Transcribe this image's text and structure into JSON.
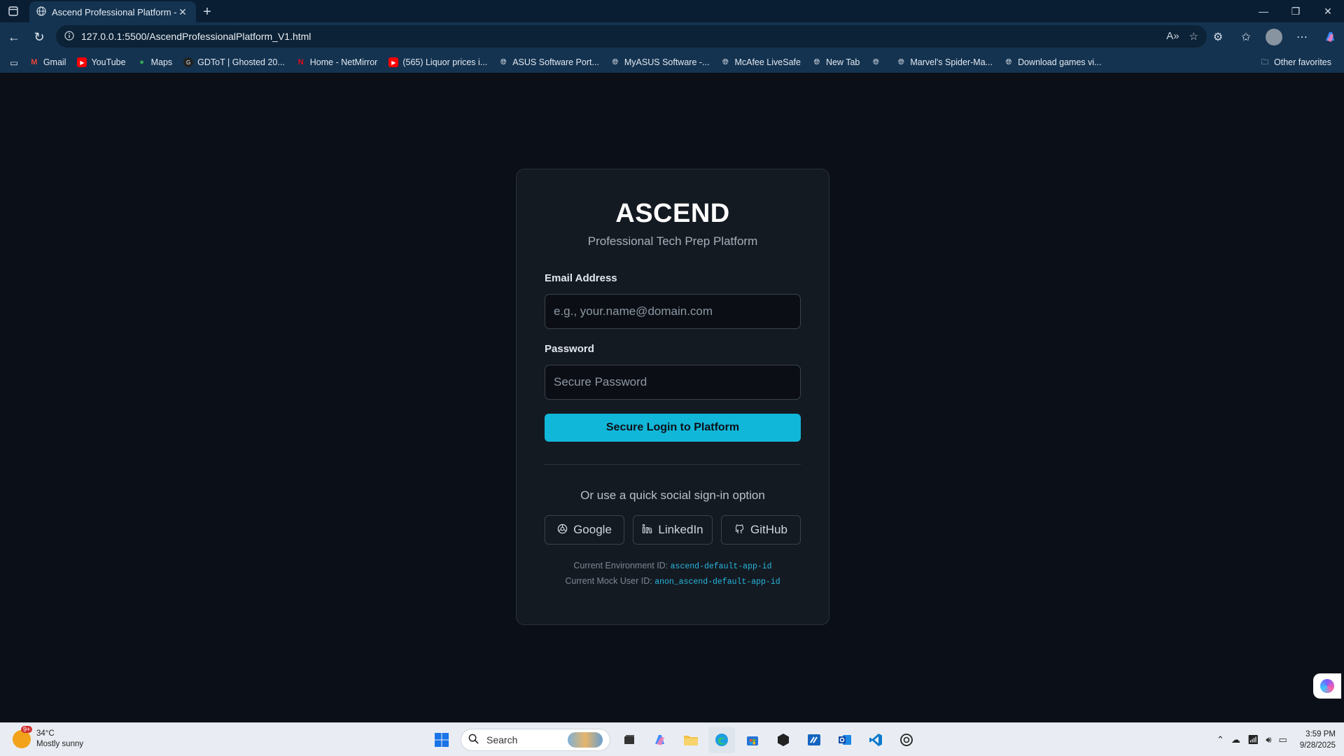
{
  "browser": {
    "tab_title": "Ascend Professional Platform - Cl",
    "url": "127.0.0.1:5500/AscendProfessionalPlatform_V1.html",
    "bookmarks": [
      "Gmail",
      "YouTube",
      "Maps",
      "GDToT | Ghosted 20...",
      "Home - NetMirror",
      "(565) Liquor prices i...",
      "ASUS Software Port...",
      "MyASUS Software -...",
      "McAfee LiveSafe",
      "New Tab",
      "",
      "Marvel's Spider-Ma...",
      "Download games vi..."
    ],
    "other_favorites": "Other favorites"
  },
  "login": {
    "brand": "ASCEND",
    "subtitle": "Professional Tech Prep Platform",
    "email_label": "Email Address",
    "email_placeholder": "e.g., your.name@domain.com",
    "password_label": "Password",
    "password_placeholder": "Secure Password",
    "login_button": "Secure Login to Platform",
    "social_text": "Or use a quick social sign-in option",
    "social": [
      "Google",
      "LinkedIn",
      "GitHub"
    ],
    "env_label": "Current Environment ID:",
    "env_id": "ascend-default-app-id",
    "user_label": "Current Mock User ID:",
    "user_id": "anon_ascend-default-app-id",
    "accent_color": "#11b7d9"
  },
  "taskbar": {
    "weather_temp": "34°C",
    "weather_desc": "Mostly sunny",
    "weather_badge": "9+",
    "search_placeholder": "Search",
    "time": "3:59 PM",
    "date": "9/28/2025"
  }
}
